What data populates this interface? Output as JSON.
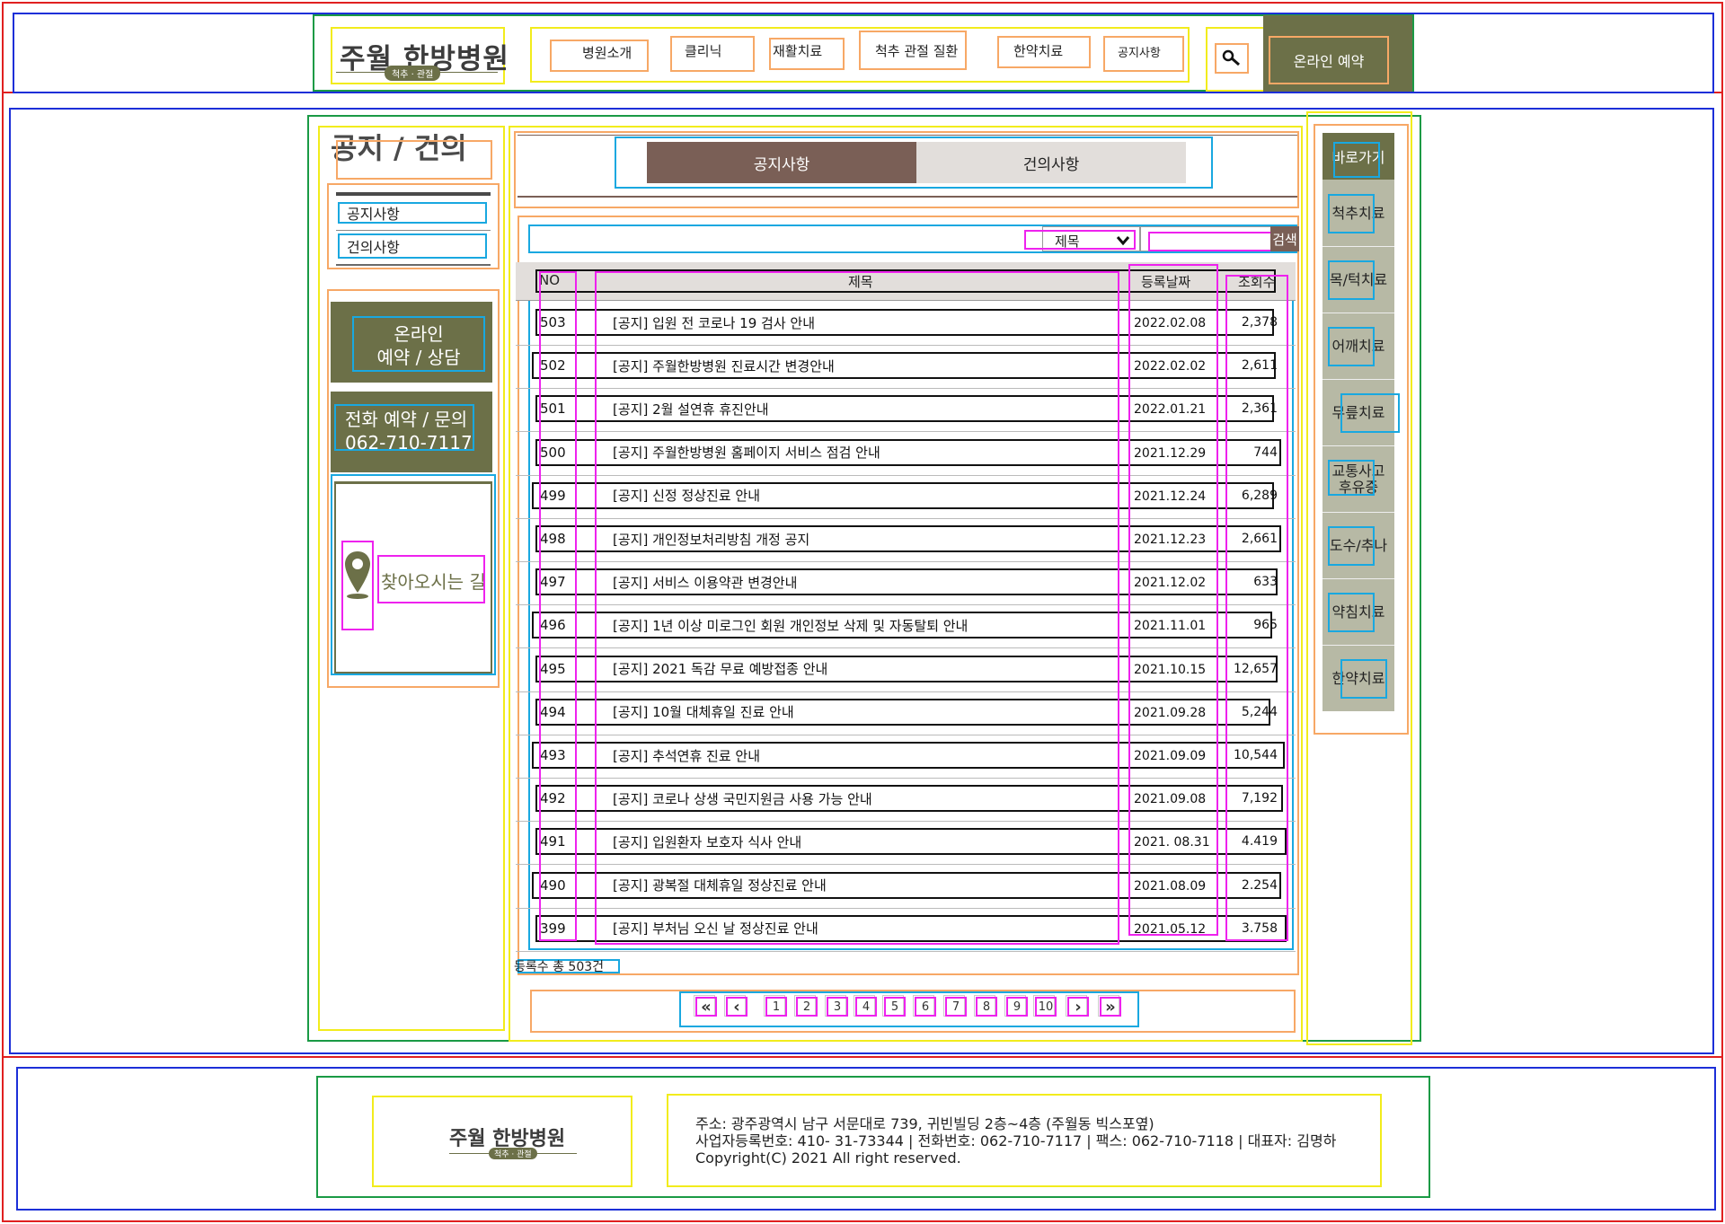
{
  "header": {
    "logo": {
      "main": "주월 한방병원",
      "sub": "척추 · 관절"
    },
    "nav": [
      "병원소개",
      "클리닉",
      "재활치료",
      "척추 관절 질환",
      "한약치료",
      "공지사항"
    ],
    "search_icon": "search-icon",
    "reserve_label": "온라인 예약"
  },
  "sidebar": {
    "title": "공지 / 건의",
    "links": [
      "공지사항",
      "건의사항"
    ],
    "online_reserve": {
      "line1": "온라인",
      "line2": "예약 / 상담"
    },
    "phone": {
      "line1": "전화 예약 / 문의",
      "line2": "062-710-7117"
    },
    "directions": {
      "label": "찾아오시는 길",
      "icon": "map-pin-icon"
    }
  },
  "board": {
    "tabs": [
      "공지사항",
      "건의사항"
    ],
    "search": {
      "select_value": "제목",
      "button_label": "검색"
    },
    "columns": [
      "NO",
      "제목",
      "등록날짜",
      "조회수"
    ],
    "rows": [
      {
        "no": "503",
        "title": "[공지] 입원 전 코로나 19 검사 안내",
        "date": "2022.02.08",
        "views": "2,378"
      },
      {
        "no": "502",
        "title": "[공지] 주월한방병원 진료시간 변경안내",
        "date": "2022.02.02",
        "views": "2,611"
      },
      {
        "no": "501",
        "title": "[공지] 2월 설연휴 휴진안내",
        "date": "2022.01.21",
        "views": "2,361"
      },
      {
        "no": "500",
        "title": "[공지] 주월한방병원 홈페이지 서비스 점검 안내",
        "date": "2021.12.29",
        "views": "744"
      },
      {
        "no": "499",
        "title": "[공지] 신정 정상진료 안내",
        "date": "2021.12.24",
        "views": "6,289"
      },
      {
        "no": "498",
        "title": "[공지] 개인정보처리방침 개정 공지",
        "date": "2021.12.23",
        "views": "2,661"
      },
      {
        "no": "497",
        "title": "[공지] 서비스 이용약관 변경안내",
        "date": "2021.12.02",
        "views": "633"
      },
      {
        "no": "496",
        "title": "[공지] 1년 이상 미로그인 회원 개인정보 삭제 및 자동탈퇴 안내",
        "date": "2021.11.01",
        "views": "965"
      },
      {
        "no": "495",
        "title": "[공지] 2021 독감 무료 예방접종 안내",
        "date": "2021.10.15",
        "views": "12,657"
      },
      {
        "no": "494",
        "title": "[공지] 10월 대체휴일 진료 안내",
        "date": "2021.09.28",
        "views": "5,244"
      },
      {
        "no": "493",
        "title": "[공지] 추석연휴 진료 안내",
        "date": "2021.09.09",
        "views": "10,544"
      },
      {
        "no": "492",
        "title": "[공지] 코로나 상생 국민지원금 사용 가능 안내",
        "date": "2021.09.08",
        "views": "7,192"
      },
      {
        "no": "491",
        "title": "[공지] 입원환자 보호자 식사 안내",
        "date": "2021. 08.31",
        "views": "4.419"
      },
      {
        "no": "490",
        "title": "[공지] 광복절 대체휴일 정상진료 안내",
        "date": "2021.08.09",
        "views": "2.254"
      },
      {
        "no": "399",
        "title": "[공지] 부처님 오신 날 정상진료 안내",
        "date": "2021.05.12",
        "views": "3.758"
      }
    ],
    "total": "등록수 총 503건",
    "pagination": {
      "first": "«",
      "prev": "‹",
      "pages": [
        "1",
        "2",
        "3",
        "4",
        "5",
        "6",
        "7",
        "8",
        "9",
        "10"
      ],
      "next": "›",
      "last": "»"
    }
  },
  "quick_menu": {
    "title": "바로가기",
    "items": [
      "척추치료",
      "목/턱치료",
      "어깨치료",
      "무릎치료",
      "교통사고\n후유증",
      "도수/추나",
      "약침치료",
      "한약치료"
    ]
  },
  "footer": {
    "logo": {
      "main": "주월 한방병원",
      "sub": "척추 · 관절"
    },
    "address": "주소: 광주광역시 남구 서문대로 739, 귀빈빌딩 2층~4층 (주월동 빅스포옆)",
    "business": "사업자등록번호: 410- 31-73344 | 전화번호: 062-710-7117 | 팩스: 062-710-7118 | 대표자: 김명하",
    "copyright": "Copyright(C) 2021 All right reserved."
  }
}
